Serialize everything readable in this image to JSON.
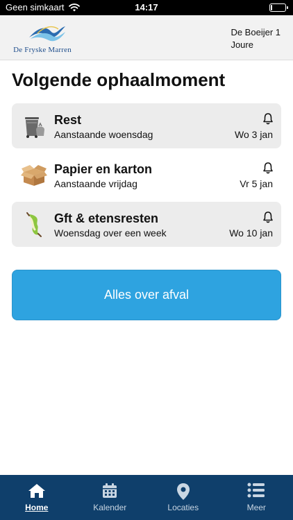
{
  "statusbar": {
    "carrier": "Geen simkaart",
    "time": "14:17",
    "battery_level": 0.12
  },
  "header": {
    "logo_text": "De Fryske Marren",
    "address_line1": "De Boeijer 1",
    "address_line2": "Joure"
  },
  "main": {
    "title": "Volgende ophaalmoment",
    "collections": [
      {
        "title": "Rest",
        "subtitle": "Aanstaande woensdag",
        "date": "Wo 3 jan",
        "icon": "trash-bin-icon"
      },
      {
        "title": "Papier en karton",
        "subtitle": "Aanstaande vrijdag",
        "date": "Vr 5 jan",
        "icon": "cardboard-box-icon"
      },
      {
        "title": "Gft & etensresten",
        "subtitle": "Woensdag over een week",
        "date": "Wo 10 jan",
        "icon": "apple-core-icon"
      }
    ],
    "cta_label": "Alles over afval"
  },
  "tabbar": {
    "tabs": [
      {
        "label": "Home",
        "icon": "home-icon",
        "active": true
      },
      {
        "label": "Kalender",
        "icon": "calendar-icon",
        "active": false
      },
      {
        "label": "Locaties",
        "icon": "location-pin-icon",
        "active": false
      },
      {
        "label": "Meer",
        "icon": "list-icon",
        "active": false
      }
    ]
  },
  "colors": {
    "accent": "#2ea3e0",
    "tabbar": "#0f3f6b",
    "card_bg": "#ececec"
  }
}
